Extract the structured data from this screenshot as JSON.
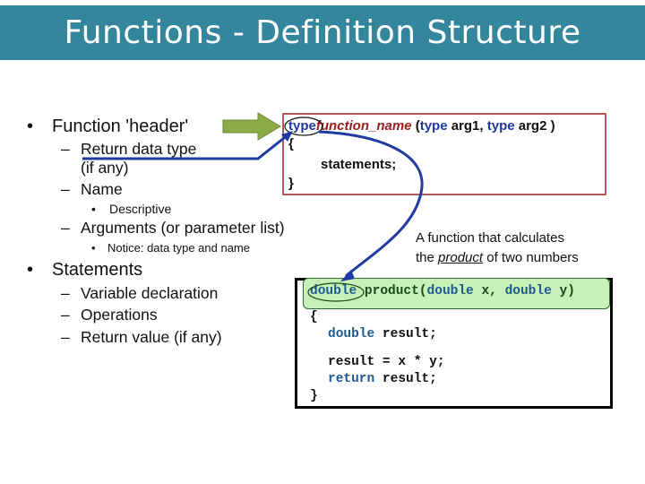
{
  "title": "Functions - Definition Structure",
  "bullets": {
    "header": "Function 'header'",
    "return_type": "Return data type",
    "return_type_cont": "(if any)",
    "name": "Name",
    "descriptive": "Descriptive",
    "arguments": "Arguments (or parameter list)",
    "notice": "Notice: data type and name",
    "statements": "Statements",
    "var_decl": "Variable declaration",
    "operations": "Operations",
    "return_value": "Return value (if any)"
  },
  "template_box": {
    "type1": "type",
    "function_name": "function_name",
    "open_paren": " (",
    "type2": "type",
    "arg1": " arg1, ",
    "type3": "type",
    "arg2": " arg2 )",
    "open_brace": "{",
    "statements": "statements;",
    "close_brace": "}"
  },
  "caption": {
    "line1": "A function that calculates",
    "line2_pre": "the ",
    "line2_em": "product",
    "line2_post": " of two numbers"
  },
  "code": {
    "sig_type": "double",
    "sig_name": " product(",
    "sig_type2": "double",
    "sig_x": " x, ",
    "sig_type3": "double",
    "sig_y": " y)",
    "open_brace": "{",
    "decl_type": "double",
    "decl_rest": " result;",
    "assign": "result = x * y;",
    "ret_kw": "return",
    "ret_rest": " result;",
    "close_brace": "}"
  },
  "colors": {
    "title_bg": "#33869c",
    "keyword": "#1f3aa0",
    "function_name": "#9b1c1c",
    "header_box_border": "#b05a5a",
    "arrow_green": "#8aab45",
    "arrow_blue": "#1f3aa0",
    "code_highlight": "#c8f0b8"
  }
}
